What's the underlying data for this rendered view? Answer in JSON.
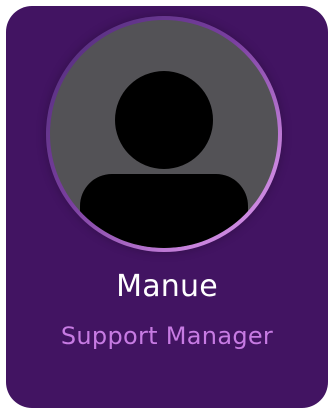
{
  "profile": {
    "name": "Manue",
    "role": "Support Manager",
    "avatar_icon": "user-silhouette-icon"
  },
  "colors": {
    "card_background": "#421462",
    "name_text": "#ffffff",
    "role_text": "#c77be3",
    "avatar_background": "#535256",
    "avatar_ring": "#c883dd"
  }
}
